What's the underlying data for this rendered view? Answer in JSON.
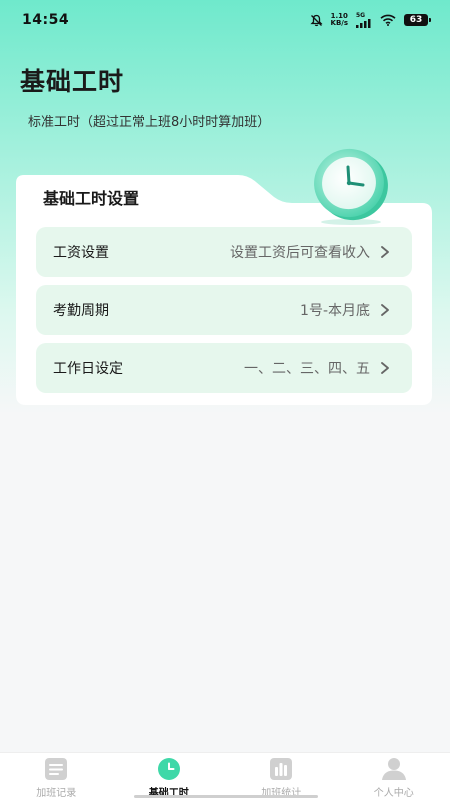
{
  "status_bar": {
    "time": "14:54",
    "net_speed_value": "1.10",
    "net_speed_unit": "KB/s",
    "network_type": "5G",
    "battery_level": "63"
  },
  "header": {
    "title": "基础工时",
    "subtitle": "标准工时（超过正常上班8小时时算加班）"
  },
  "settings_card": {
    "title": "基础工时设置",
    "items": [
      {
        "label": "工资设置",
        "value": "设置工资后可查看收入"
      },
      {
        "label": "考勤周期",
        "value": "1号-本月底"
      },
      {
        "label": "工作日设定",
        "value": "一、二、三、四、五"
      }
    ]
  },
  "tab_bar": {
    "tabs": [
      {
        "label": "加班记录",
        "icon": "document-icon",
        "active": false
      },
      {
        "label": "基础工时",
        "icon": "clock-icon",
        "active": true
      },
      {
        "label": "加班统计",
        "icon": "bar-chart-icon",
        "active": false
      },
      {
        "label": "个人中心",
        "icon": "person-icon",
        "active": false
      }
    ]
  },
  "colors": {
    "accent": "#3fd8a8",
    "header_gradient_top": "#6fe9cc",
    "row_background": "#e6f7ed",
    "inactive_tab": "#d0d0d0"
  }
}
